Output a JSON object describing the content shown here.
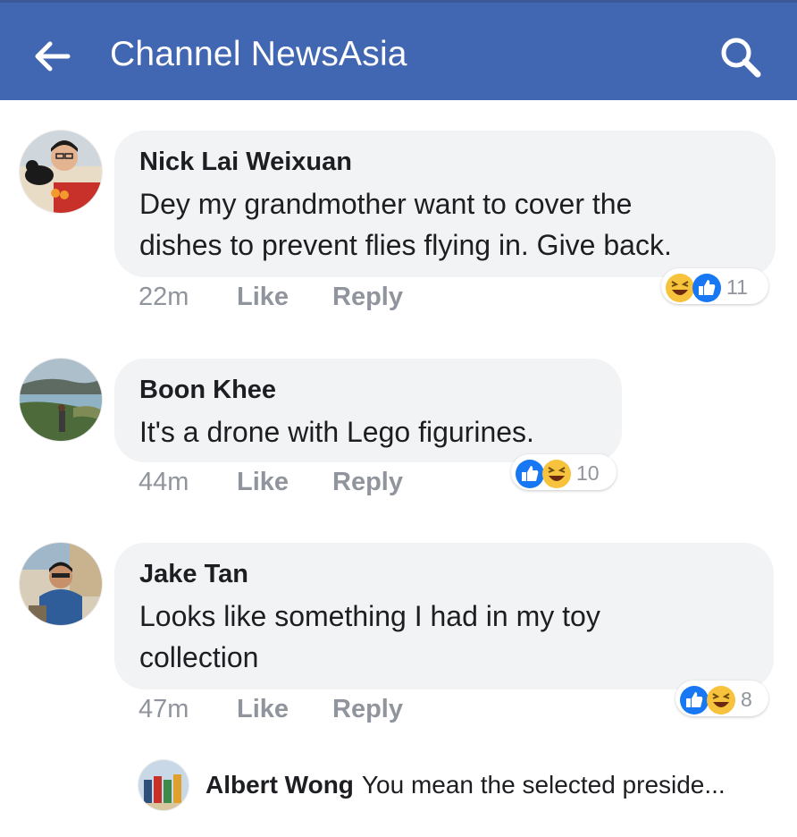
{
  "header": {
    "title": "Channel NewsAsia",
    "background": "#4267b2"
  },
  "comments": [
    {
      "author": "Nick Lai Weixuan",
      "text_line1": "Dey my grandmother want to cover the",
      "text_line2": "dishes to prevent flies flying in. Give back.",
      "time": "22m",
      "like_label": "Like",
      "reply_label": "Reply",
      "reaction_icons": [
        "haha-icon",
        "like-icon"
      ],
      "reaction_count": "11"
    },
    {
      "author": "Boon Khee",
      "text_line1": "It's a drone with Lego figurines.",
      "time": "44m",
      "like_label": "Like",
      "reply_label": "Reply",
      "reaction_icons": [
        "like-icon",
        "haha-icon"
      ],
      "reaction_count": "10"
    },
    {
      "author": "Jake Tan",
      "text_line1": "Looks like something I had in my toy",
      "text_line2": "collection",
      "time": "47m",
      "like_label": "Like",
      "reply_label": "Reply",
      "reaction_icons": [
        "like-icon",
        "haha-icon"
      ],
      "reaction_count": "8"
    }
  ],
  "reply_preview": {
    "author": "Albert Wong",
    "text": "You mean the selected preside..."
  },
  "colors": {
    "like_blue": "#1877f2",
    "haha_yellow": "#f7c23c",
    "meta_gray": "#90949c"
  }
}
